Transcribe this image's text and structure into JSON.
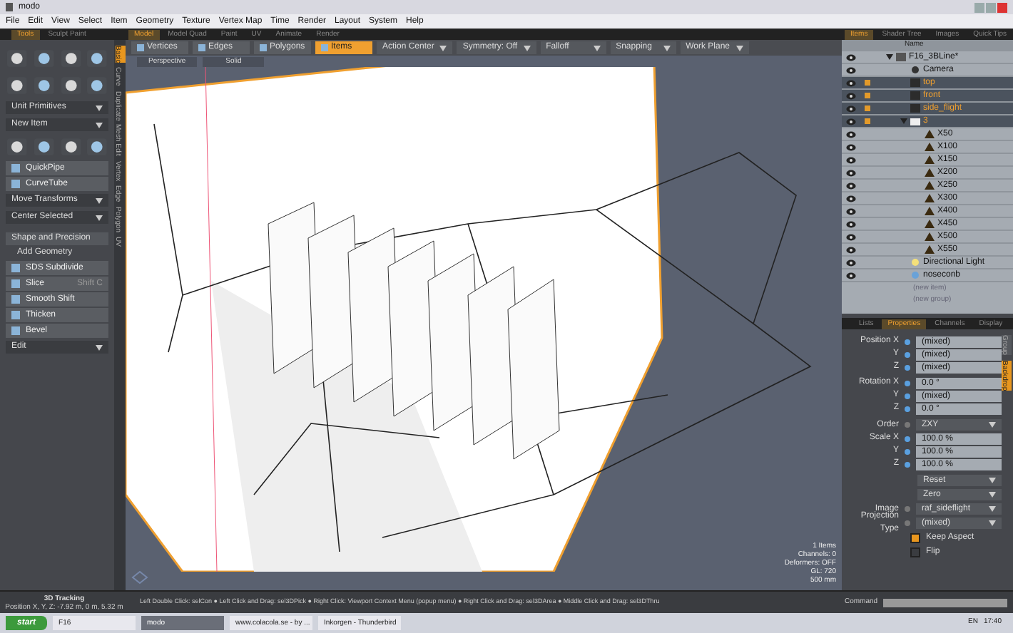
{
  "window": {
    "title": "modo"
  },
  "menu": [
    "File",
    "Edit",
    "View",
    "Select",
    "Item",
    "Geometry",
    "Texture",
    "Vertex Map",
    "Time",
    "Render",
    "Layout",
    "System",
    "Help"
  ],
  "left_tabs": [
    {
      "label": "Tools",
      "selected": true
    },
    {
      "label": "Sculpt Paint",
      "selected": false
    }
  ],
  "layout_tabs": [
    {
      "label": "Model",
      "selected": true
    },
    {
      "label": "Model Quad",
      "selected": false
    },
    {
      "label": "Paint",
      "selected": false
    },
    {
      "label": "UV",
      "selected": false
    },
    {
      "label": "Animate",
      "selected": false
    },
    {
      "label": "Render",
      "selected": false
    }
  ],
  "tools": [
    {
      "kind": "icons"
    },
    {
      "kind": "icons"
    },
    {
      "kind": "dropdown",
      "label": "Unit Primitives"
    },
    {
      "kind": "dropdown",
      "label": "New Item"
    },
    {
      "kind": "icons"
    },
    {
      "kind": "tool",
      "label": "QuickPipe"
    },
    {
      "kind": "tool",
      "label": "CurveTube"
    },
    {
      "kind": "dropdown",
      "label": "Move Transforms"
    },
    {
      "kind": "dropdown",
      "label": "Center Selected"
    },
    {
      "kind": "header",
      "label": "Shape and Precision"
    },
    {
      "kind": "subheader",
      "label": "Add Geometry"
    },
    {
      "kind": "tool",
      "label": "SDS Subdivide"
    },
    {
      "kind": "tool",
      "label": "Slice",
      "shortcut": "Shift C"
    },
    {
      "kind": "tool",
      "label": "Smooth Shift"
    },
    {
      "kind": "tool",
      "label": "Thicken"
    },
    {
      "kind": "tool",
      "label": "Bevel"
    },
    {
      "kind": "dropdown",
      "label": "Edit"
    }
  ],
  "vertical_tabs": [
    {
      "label": "Basic",
      "selected": true
    },
    {
      "label": "Curve",
      "selected": false
    },
    {
      "label": "Duplicate",
      "selected": false
    },
    {
      "label": "Mesh Edit",
      "selected": false
    },
    {
      "label": "Vertex",
      "selected": false
    },
    {
      "label": "Edge",
      "selected": false
    },
    {
      "label": "Polygon",
      "selected": false
    },
    {
      "label": "UV",
      "selected": false
    }
  ],
  "mode_buttons": [
    {
      "label": "Vertices",
      "selected": false
    },
    {
      "label": "Edges",
      "selected": false
    },
    {
      "label": "Polygons",
      "selected": false
    },
    {
      "label": "Items",
      "selected": true
    }
  ],
  "toolbar_dropdowns": [
    "Action Center",
    "Symmetry: Off",
    "Falloff",
    "Snapping",
    "Work Plane"
  ],
  "viewport": {
    "view": "Perspective",
    "shading": "Solid",
    "info": [
      "1 Items",
      "Channels: 0",
      "Deformers: OFF",
      "GL: 720",
      "500 mm"
    ]
  },
  "status_bar": {
    "title": "3D Tracking",
    "position": "Position X, Y, Z:  -7.92 m, 0 m, 5.32 m",
    "hints": "Left Double Click: selCon ● Left Click and Drag: sel3DPick ● Right Click: Viewport Context Menu (popup menu) ● Right Click and Drag: sel3DArea ● Middle Click and Drag: sel3DThru",
    "command_label": "Command"
  },
  "item_tabs": [
    {
      "label": "Items",
      "selected": true
    },
    {
      "label": "Shader Tree",
      "selected": false
    },
    {
      "label": "Images",
      "selected": false
    },
    {
      "label": "Quick Tips",
      "selected": false
    }
  ],
  "item_list": {
    "column": "Name",
    "tree": [
      {
        "label": "F16_3BLine*",
        "kind": "scene",
        "expanded": true,
        "selected": false,
        "children": [
          {
            "label": "Camera",
            "kind": "camera",
            "selected": false
          },
          {
            "label": "top",
            "kind": "backdrop",
            "selected": true
          },
          {
            "label": "front",
            "kind": "backdrop",
            "selected": true
          },
          {
            "label": "side_flight",
            "kind": "backdrop",
            "selected": true
          },
          {
            "label": "3",
            "kind": "group",
            "expanded": true,
            "selected": true,
            "children": [
              {
                "label": "X50",
                "kind": "mesh",
                "selected": false
              },
              {
                "label": "X100",
                "kind": "mesh",
                "selected": false
              },
              {
                "label": "X150",
                "kind": "mesh",
                "selected": false
              },
              {
                "label": "X200",
                "kind": "mesh",
                "selected": false
              },
              {
                "label": "X250",
                "kind": "mesh",
                "selected": false
              },
              {
                "label": "X300",
                "kind": "mesh",
                "selected": false
              },
              {
                "label": "X400",
                "kind": "mesh",
                "selected": false
              },
              {
                "label": "X450",
                "kind": "mesh",
                "selected": false
              },
              {
                "label": "X500",
                "kind": "mesh",
                "selected": false
              },
              {
                "label": "X550",
                "kind": "mesh",
                "selected": false
              }
            ]
          },
          {
            "label": "Directional Light",
            "kind": "light",
            "selected": false
          },
          {
            "label": "noseconb",
            "kind": "mesh2",
            "selected": false
          }
        ]
      }
    ],
    "extras": [
      "(new item)",
      "(new group)"
    ]
  },
  "prop_tabs": [
    {
      "label": "Lists",
      "selected": false
    },
    {
      "label": "Properties",
      "selected": true
    },
    {
      "label": "Channels",
      "selected": false
    },
    {
      "label": "Display",
      "selected": false
    }
  ],
  "side_tabs": [
    {
      "label": "Group",
      "selected": false
    },
    {
      "label": "Backdrop",
      "selected": true
    }
  ],
  "properties": [
    {
      "kind": "vector",
      "label": "Position",
      "axes": [
        {
          "axis": "X",
          "value": "(mixed)"
        },
        {
          "axis": "Y",
          "value": "(mixed)"
        },
        {
          "axis": "Z",
          "value": "(mixed)"
        }
      ]
    },
    {
      "kind": "vector",
      "label": "Rotation",
      "axes": [
        {
          "axis": "X",
          "value": "0.0 °"
        },
        {
          "axis": "Y",
          "value": "(mixed)"
        },
        {
          "axis": "Z",
          "value": "0.0 °"
        }
      ]
    },
    {
      "kind": "select",
      "label": "Order",
      "value": "ZXY"
    },
    {
      "kind": "vector",
      "label": "Scale",
      "axes": [
        {
          "axis": "X",
          "value": "100.0 %"
        },
        {
          "axis": "Y",
          "value": "100.0 %"
        },
        {
          "axis": "Z",
          "value": "100.0 %"
        }
      ]
    },
    {
      "kind": "action",
      "value": "Reset"
    },
    {
      "kind": "action",
      "value": "Zero"
    },
    {
      "kind": "select",
      "label": "Image",
      "value": "raf_sideflight"
    },
    {
      "kind": "select",
      "label": "Projection Type",
      "value": "(mixed)"
    },
    {
      "kind": "check",
      "label": "Keep Aspect",
      "checked": true
    },
    {
      "kind": "check",
      "label": "Flip",
      "checked": false
    }
  ],
  "taskbar": {
    "start": "start",
    "tasks": [
      {
        "label": "F16",
        "selected": false
      },
      {
        "label": "modo",
        "selected": true
      },
      {
        "label": "www.colacola.se - by ...",
        "selected": false
      },
      {
        "label": "Inkorgen - Thunderbird",
        "selected": false
      }
    ],
    "language": "EN",
    "clock": "17:40"
  }
}
